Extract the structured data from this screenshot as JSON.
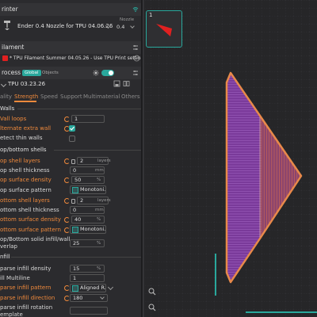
{
  "printer": {
    "section_title": "rinter",
    "name": "Ender 0.4 Nozzle for TPU 04.06.26",
    "nozzle_label": "Nozzle",
    "nozzle_value": "0.4"
  },
  "filament": {
    "section_title": "ilament",
    "entry": "* TPU Filament Summer 04.05.26 - Use TPU Print setting",
    "color": "#e02020"
  },
  "process": {
    "section_title": "rocess",
    "global_badge": "Global",
    "objects_badge": "Objects",
    "preset": "TPU 03.23.26"
  },
  "tabs": [
    {
      "label": "ality",
      "active": false
    },
    {
      "label": "Strength",
      "active": true
    },
    {
      "label": "Speed",
      "active": false
    },
    {
      "label": "Support",
      "active": false
    },
    {
      "label": "Multimaterial",
      "active": false
    },
    {
      "label": "Others",
      "active": false
    }
  ],
  "walls": {
    "title": "Walls",
    "wall_loops_label": "Vall loops",
    "wall_loops_value": "1",
    "alternate_label": "lternate extra wall",
    "alternate_checked": true,
    "detect_label": "etect thin walls",
    "detect_checked": false
  },
  "topbottom": {
    "title": "op/bottom shells",
    "top_layers_label": "op shell layers",
    "top_layers_value": "2",
    "top_layers_unit": "layers",
    "top_thickness_label": "op shell thickness",
    "top_thickness_value": "0",
    "top_thickness_unit": "mm",
    "top_density_label": "op surface density",
    "top_density_value": "50",
    "top_density_unit": "%",
    "top_pattern_label": "op surface pattern",
    "top_pattern_value": "Monotoni...",
    "bottom_layers_label": "ottom shell layers",
    "bottom_layers_value": "2",
    "bottom_layers_unit": "layers",
    "bottom_thickness_label": "ottom shell thickness",
    "bottom_thickness_value": "0",
    "bottom_thickness_unit": "mm",
    "bottom_density_label": "ottom surface density",
    "bottom_density_value": "40",
    "bottom_density_unit": "%",
    "bottom_pattern_label": "ottom surface pattern",
    "bottom_pattern_value": "Monotoni...",
    "solid_overlap_label_1": "op/Bottom solid infill/wall",
    "solid_overlap_label_2": "verlap",
    "solid_overlap_value": "25",
    "solid_overlap_unit": "%"
  },
  "infill": {
    "title": "nfill",
    "sparse_density_label": "parse infill density",
    "sparse_density_value": "15",
    "sparse_density_unit": "%",
    "multiline_label": "ill Multiline",
    "multiline_value": "1",
    "sparse_pattern_label": "parse infill pattern",
    "sparse_pattern_value": "Aligned R...",
    "sparse_direction_label": "parse infill direction",
    "sparse_direction_value": "180",
    "rotation_label_1": "parse infill rotation",
    "rotation_label_2": "emplate"
  },
  "plate": {
    "number": "1"
  },
  "colors": {
    "accent": "#f08a3c",
    "teal": "#29a89c",
    "model_fill": "#8a3ea8",
    "model_outline": "#e8894a"
  }
}
